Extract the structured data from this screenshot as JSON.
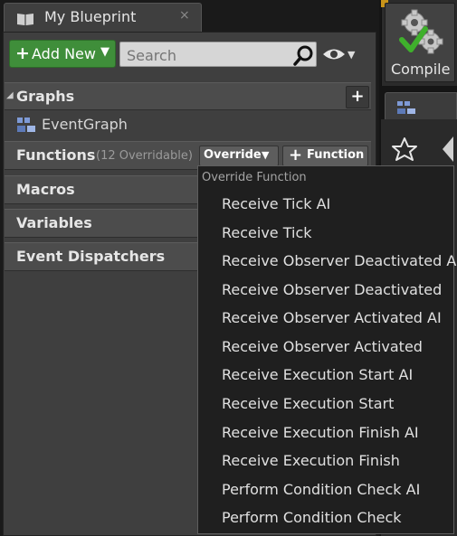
{
  "tab": {
    "title": "My Blueprint",
    "close": "×",
    "icon": "book-icon"
  },
  "toolbar": {
    "add_new_label": "Add New",
    "search_placeholder": "Search",
    "accent_color": "#3f8e3a"
  },
  "sections": {
    "graphs": {
      "title": "Graphs",
      "items": [
        "EventGraph"
      ]
    },
    "functions": {
      "title": "Functions",
      "count": "(12 Overridable)",
      "override_label": "Override",
      "function_label": "Function"
    },
    "macros": {
      "title": "Macros"
    },
    "variables": {
      "title": "Variables"
    },
    "event_dispatchers": {
      "title": "Event Dispatchers"
    }
  },
  "right": {
    "compile_label": "Compile"
  },
  "dropdown": {
    "header": "Override Function",
    "items": [
      "Receive Tick AI",
      "Receive Tick",
      "Receive Observer Deactivated AI",
      "Receive Observer Deactivated",
      "Receive Observer Activated AI",
      "Receive Observer Activated",
      "Receive Execution Start AI",
      "Receive Execution Start",
      "Receive Execution Finish AI",
      "Receive Execution Finish",
      "Perform Condition Check AI",
      "Perform Condition Check"
    ]
  }
}
